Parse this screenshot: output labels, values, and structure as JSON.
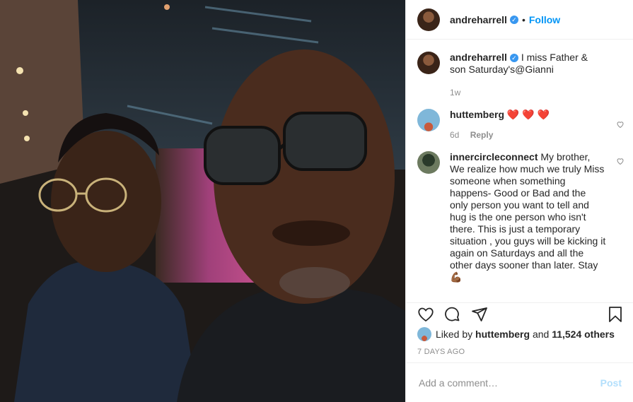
{
  "post": {
    "username": "andreharrell",
    "follow_label": "Follow",
    "dot": "•",
    "verified_mark": "✓"
  },
  "caption": {
    "username": "andreharrell",
    "text": "I miss Father & son Saturday's@Gianni",
    "time": "1w"
  },
  "comments": [
    {
      "username": "huttemberg",
      "text": "❤️ ❤️ ❤️",
      "time": "6d",
      "reply_label": "Reply"
    },
    {
      "username": "innercircleconnect",
      "text": "My brother, We realize how much we truly Miss someone when something happens- Good or Bad and the only person you want to tell and hug is the one person who isn't there. This is just a temporary situation , you guys will be kicking it again on Saturdays and all the other days sooner than later. Stay 💪🏾"
    }
  ],
  "likes": {
    "prefix": "Liked by",
    "user": "huttemberg",
    "and": "and",
    "count": "11,524 others"
  },
  "timestamp": "7 DAYS AGO",
  "add_comment": {
    "placeholder": "Add a comment…",
    "post_label": "Post"
  },
  "icons": [
    "heart-outline-icon",
    "comment-icon",
    "share-icon",
    "bookmark-icon"
  ],
  "colors": {
    "accent": "#0095f6",
    "post_disabled": "#b2dffc",
    "muted": "#8e8e8e"
  }
}
